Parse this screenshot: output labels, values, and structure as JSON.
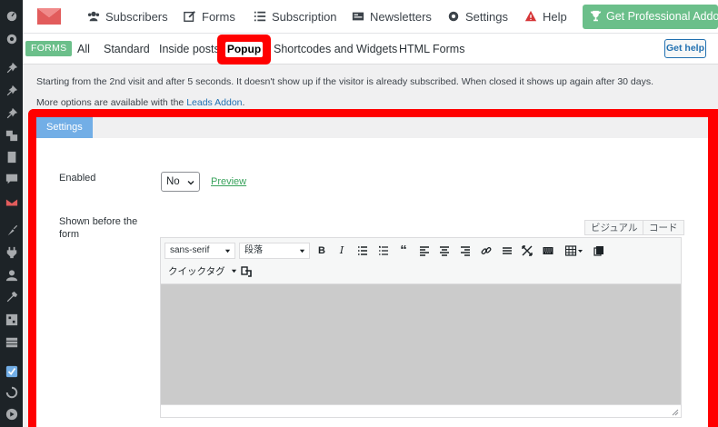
{
  "header": {
    "nav": [
      {
        "label": "Subscribers",
        "icon": "users-icon"
      },
      {
        "label": "Forms",
        "icon": "edit-icon"
      },
      {
        "label": "Subscription",
        "icon": "list-icon"
      },
      {
        "label": "Newsletters",
        "icon": "newspaper-icon"
      },
      {
        "label": "Settings",
        "icon": "gear-icon"
      },
      {
        "label": "Help",
        "icon": "warning-icon"
      }
    ],
    "pro_button": "Get Professional Addons",
    "brand_color": "#e25c5c",
    "accent_color": "#6bbf8a"
  },
  "subtabs": {
    "badge": "FORMS",
    "items": [
      "All",
      "Standard",
      "Inside posts",
      "Popup",
      "Shortcodes and Widgets",
      "HTML Forms"
    ],
    "active": "Popup",
    "help": "Get help"
  },
  "info": {
    "line1": "Starting from the 2nd visit and after 5 seconds. It doesn't show up if the visitor is already subscribed. When closed it shows up again after 30 days.",
    "line2_prefix": "More options are available with the ",
    "line2_link": "Leads Addon",
    "line2_suffix": "."
  },
  "panel": {
    "tab": "Settings",
    "enabled_label": "Enabled",
    "enabled_value": "No",
    "preview": "Preview",
    "shown_before_label": "Shown before the form"
  },
  "editor": {
    "visual_tab": "ビジュアル",
    "code_tab": "コード",
    "font_select": "sans-serif",
    "format_select": "段落",
    "quick_tag": "クイックタグ"
  }
}
